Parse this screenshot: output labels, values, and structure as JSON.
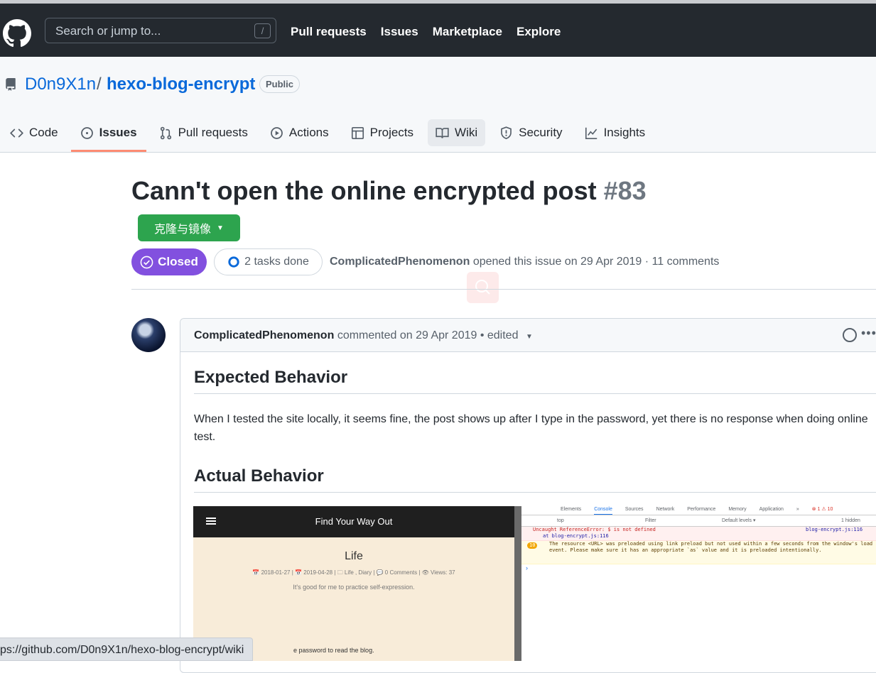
{
  "header": {
    "search_placeholder": "Search or jump to...",
    "search_key": "/",
    "nav": [
      "Pull requests",
      "Issues",
      "Marketplace",
      "Explore"
    ]
  },
  "repo": {
    "owner": "D0n9X1n",
    "separator": "/",
    "name": "hexo-blog-encrypt",
    "visibility": "Public"
  },
  "tabs": [
    "Code",
    "Issues",
    "Pull requests",
    "Actions",
    "Projects",
    "Wiki",
    "Security",
    "Insights"
  ],
  "issue": {
    "title": "Cann't open the online encrypted post",
    "number": "#83",
    "clone_button": "克隆与镜像",
    "state": "Closed",
    "tasks": "2 tasks done",
    "author": "ComplicatedPhenomenon",
    "opened_text": "opened this issue on 29 Apr 2019 · 11 comments"
  },
  "comment": {
    "author": "ComplicatedPhenomenon",
    "action": "commented on 29 Apr 2019 • edited",
    "h_expected": "Expected Behavior",
    "body": "When I tested the site locally, it seems fine, the post shows up after I type in the password, yet there is no response when doing online test.",
    "h_actual": "Actual Behavior"
  },
  "screenshot": {
    "site_title": "Find Your Way Out",
    "post_title": "Life",
    "post_meta": "📅 2018-01-27  |  📅 2019-04-28  |  🗀 Life , Diary  |  💬 0 Comments  |  👁 Views: 37",
    "post_desc": "It's good for me to practice self-expression.",
    "password_prompt": "e password to read the blog.",
    "devtools_tabs": [
      "Elements",
      "Console",
      "Sources",
      "Network",
      "Performance",
      "Memory",
      "Application",
      "»"
    ],
    "devtools_counts": "⊗ 1  ⚠ 10",
    "filter_context": "top",
    "filter_placeholder": "Filter",
    "levels": "Default levels ▾",
    "hidden": "1 hidden",
    "error_msg": "Uncaught ReferenceError: $ is not defined",
    "error_at": "at blog-encrypt.js:116",
    "error_src": "blog-encrypt.js:116",
    "warn_count": "10",
    "warn_msg": "The resource <URL> was preloaded using link preload but not used within a few seconds from the window's load event. Please make sure it has an appropriate `as` value and it is preloaded intentionally."
  },
  "status_url": "ps://github.com/D0n9X1n/hexo-blog-encrypt/wiki"
}
